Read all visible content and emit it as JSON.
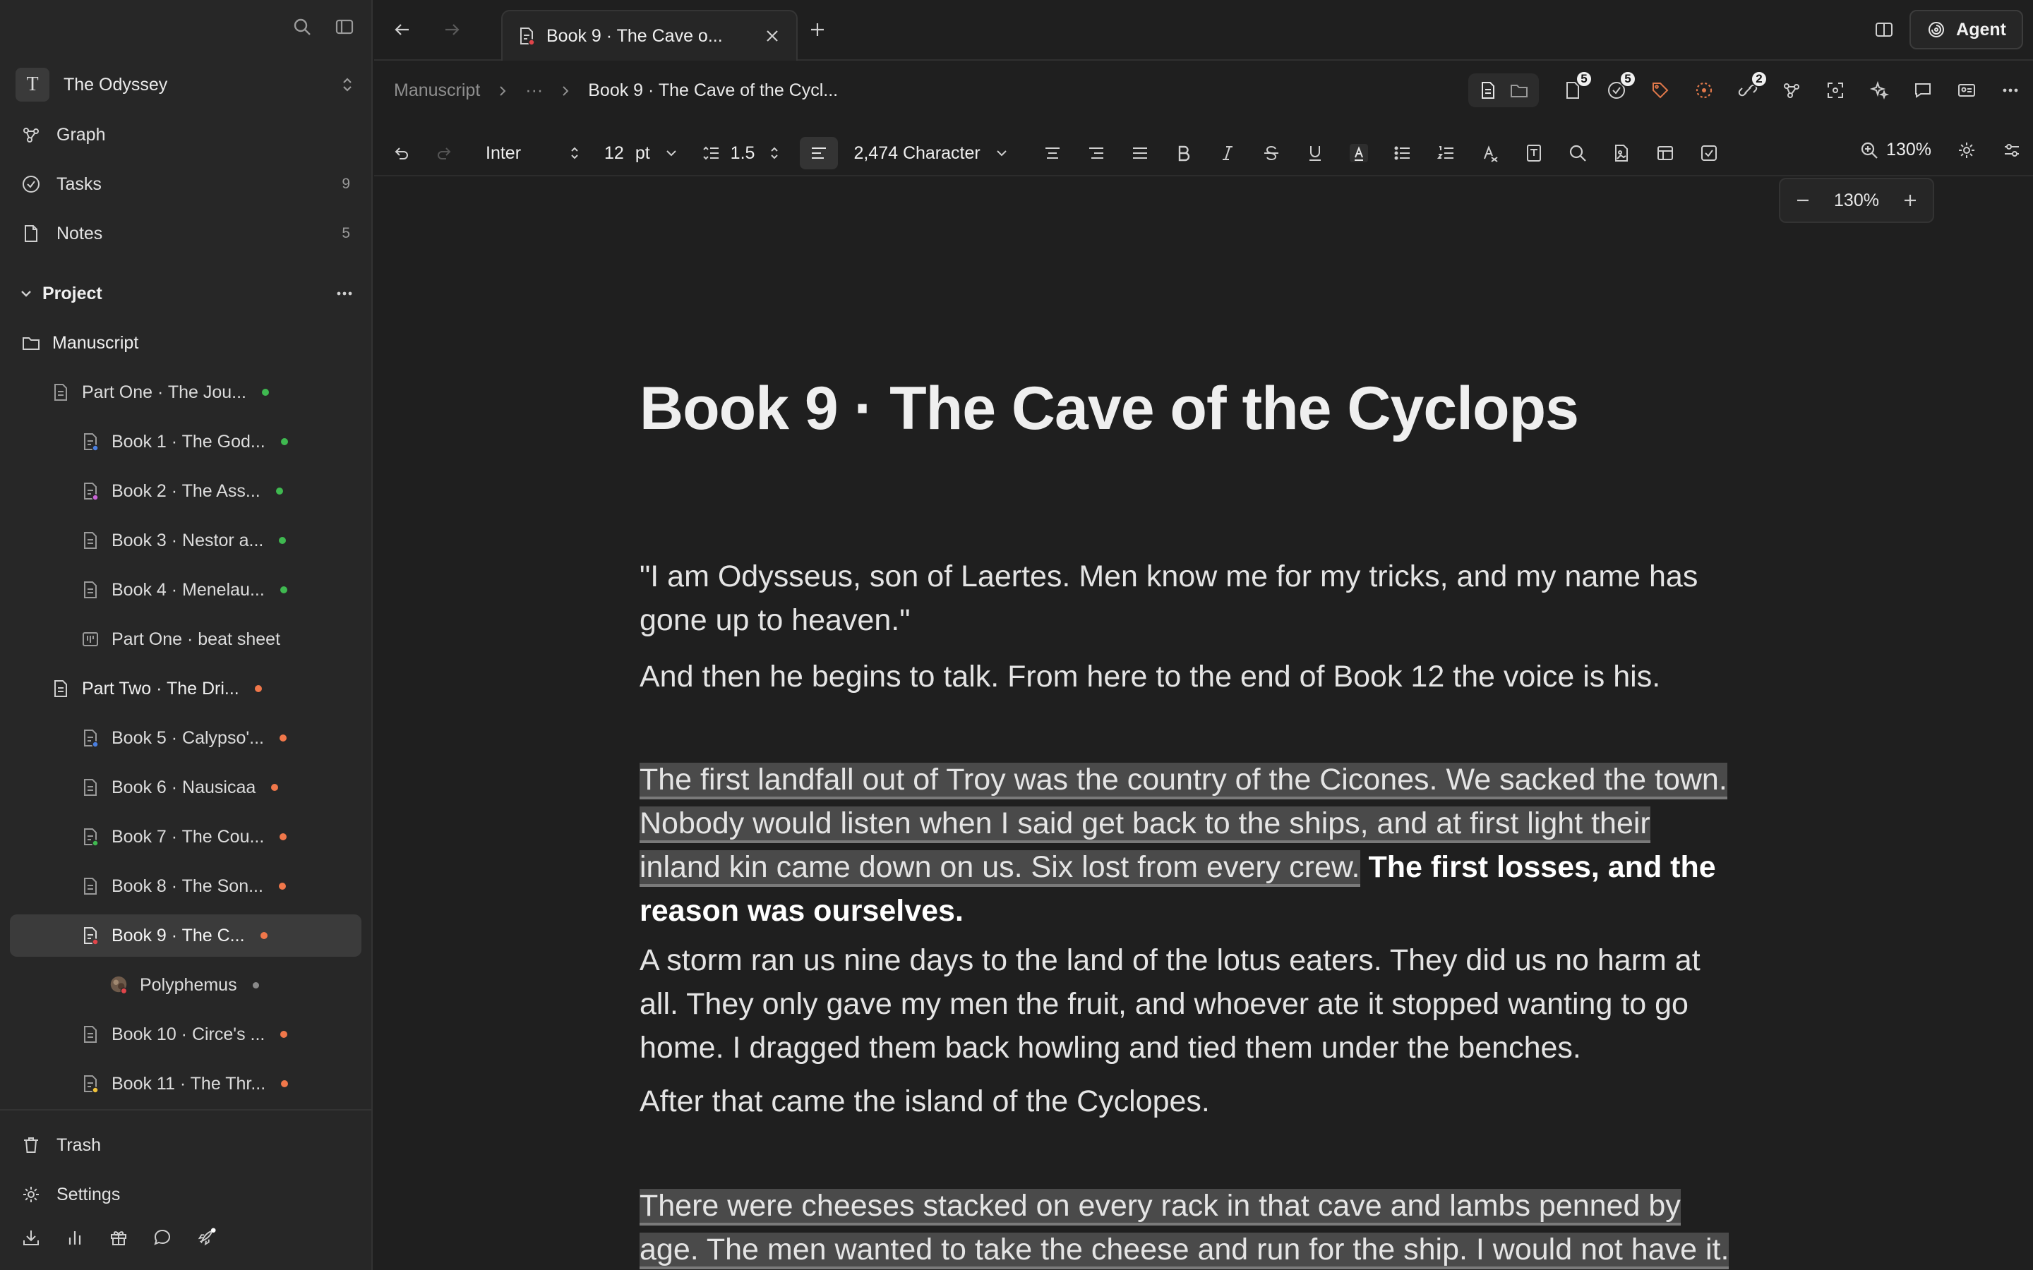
{
  "sidebar": {
    "workspace": {
      "initial": "T",
      "name": "The Odyssey"
    },
    "nav": [
      {
        "label": "Graph",
        "count": ""
      },
      {
        "label": "Tasks",
        "count": "9"
      },
      {
        "label": "Notes",
        "count": "5"
      }
    ],
    "project_label": "Project",
    "tree": [
      {
        "label": "Manuscript"
      },
      {
        "label": "Part One · The Jou..."
      },
      {
        "label": "Book 1 · The God..."
      },
      {
        "label": "Book 2 · The Ass..."
      },
      {
        "label": "Book 3 · Nestor a..."
      },
      {
        "label": "Book 4 · Menelau..."
      },
      {
        "label": "Part One · beat sheet"
      },
      {
        "label": "Part Two · The Dri..."
      },
      {
        "label": "Book 5 · Calypso'..."
      },
      {
        "label": "Book 6 · Nausicaa"
      },
      {
        "label": "Book 7 · The Cou..."
      },
      {
        "label": "Book 8 · The Son..."
      },
      {
        "label": "Book 9 · The C..."
      },
      {
        "label": "Polyphemus"
      },
      {
        "label": "Book 10 · Circe's ..."
      },
      {
        "label": "Book 11 · The Thr..."
      }
    ],
    "trash_label": "Trash",
    "settings_label": "Settings"
  },
  "colors": {
    "green_dot": "#3fb950",
    "orange_dot": "#f0774a",
    "grey_dot": "#8a8a8a",
    "blue_mark": "#4a7fe0",
    "pink_mark": "#c964d6",
    "red_mark": "#e0454a",
    "green_mark": "#3fb950",
    "yellow_mark": "#f0c23a",
    "tag_orange": "#e0784a"
  },
  "topbar": {
    "tab_title": "Book 9 · The Cave o...",
    "agent_label": "Agent"
  },
  "breadcrumb": {
    "root": "Manuscript",
    "ellipsis": "···",
    "current": "Book 9 · The Cave of the Cycl..."
  },
  "badges": {
    "docs": "5",
    "tasks": "5",
    "links": "2"
  },
  "toolbar": {
    "font": "Inter",
    "size": "12",
    "size_unit": "pt",
    "line_height": "1.5",
    "count": "2,474 Character",
    "zoom": "130%"
  },
  "zoom_popover": {
    "value": "130%"
  },
  "document": {
    "title": "Book 9 · The Cave of the Cyclops",
    "p1": "\"I am Odysseus, son of Laertes. Men know me for my tricks, and my name has gone up to heaven.\"",
    "p2": "And then he begins to talk. From here to the end of Book 12 the voice is his.",
    "p3_line1": "The first landfall out of Troy was the country of the Cicones. We sacked the town.",
    "p3_line2": "Nobody would listen when I said get back to the ships, and at first light their",
    "p3_line3": "inland kin came down on us. Six lost from every crew.",
    "p3_bold": "The first losses, and the reason was ourselves.",
    "p4": "A storm ran us nine days to the land of the lotus eaters. They did us no harm at all. They only gave my men the fruit, and whoever ate it stopped wanting to go home. I dragged them back howling and tied them under the benches.",
    "p5": "After that came the island of the Cyclopes.",
    "p6_line1": "There were cheeses stacked on every rack in that cave and lambs penned by",
    "p6_line2": "age. The men wanted to take the cheese and run for the ship. I would not have it."
  }
}
